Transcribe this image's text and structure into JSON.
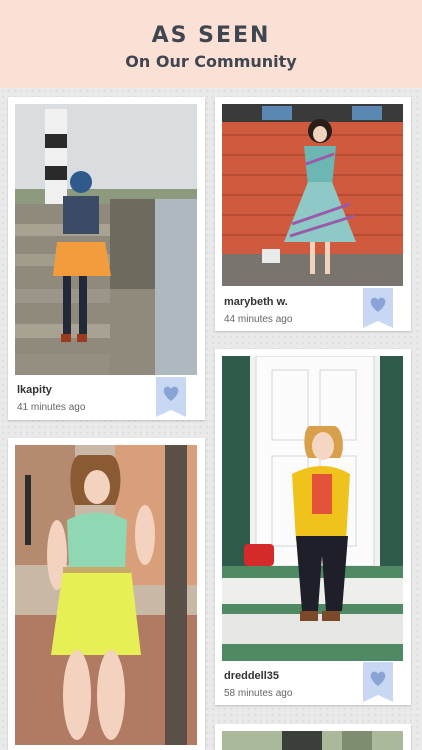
{
  "header": {
    "title": "AS SEEN",
    "subtitle": "On Our Community"
  },
  "posts": [
    {
      "username": "lkapity",
      "time": "41 minutes ago"
    },
    {
      "username": "marybeth w.",
      "time": "44 minutes ago"
    },
    {
      "username": "",
      "time": ""
    },
    {
      "username": "dreddell35",
      "time": "58 minutes ago"
    }
  ],
  "colors": {
    "header_bg": "#fbe0d6",
    "title_text": "#3f4650",
    "favorite_ribbon": "#c9d8f2",
    "favorite_heart": "#8aa4d8"
  },
  "icons": {
    "favorite": "heart-ribbon-icon"
  }
}
